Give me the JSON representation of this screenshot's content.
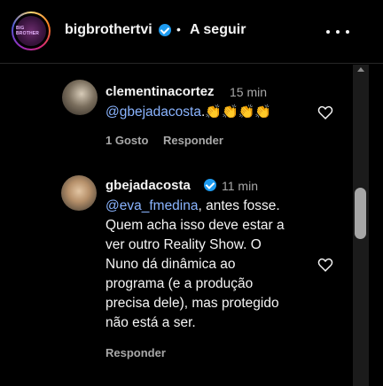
{
  "header": {
    "username": "bigbrothertvi",
    "separator": "•",
    "follow_label": "A seguir",
    "avatar_text": "BIG BROTHER"
  },
  "comments": [
    {
      "username": "clementinacortez",
      "time": "15 min",
      "mention": "@gbejadacosta",
      "text_after_mention": ".",
      "emojis": "👏👏👏👏",
      "likes_label": "1 Gosto",
      "reply_label": "Responder"
    },
    {
      "username": "gbejadacosta",
      "verified": true,
      "time": "11 min",
      "mention": "@eva_fmedina",
      "text_after_mention": ", antes fosse.",
      "lines": [
        "Quem acha isso deve estar a",
        "ver outro Reality Show. O",
        "Nuno dá dinâmica ao",
        "programa (e a produção",
        "precisa dele), mas protegido",
        "não está a ser."
      ],
      "reply_label": "Responder"
    }
  ],
  "colors": {
    "background": "#000000",
    "text": "#f5f5f5",
    "secondary": "#a8a8a8",
    "mention": "#8ab4ff",
    "verified": "#1d9bf0"
  },
  "icons": [
    "more-options-icon",
    "verified-badge-icon",
    "heart-icon",
    "scroll-up-arrow-icon"
  ]
}
